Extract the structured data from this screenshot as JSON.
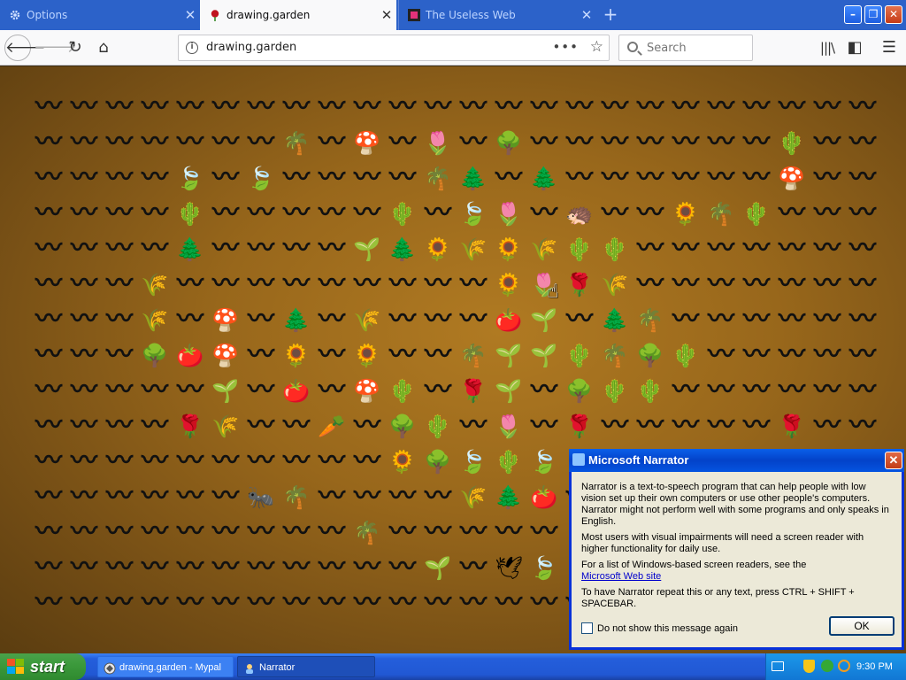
{
  "browser": {
    "tabs": [
      {
        "label": "Options",
        "icon": "gear-icon"
      },
      {
        "label": "drawing.garden",
        "icon": "rose-icon"
      },
      {
        "label": "The Useless Web",
        "icon": "pink-square-icon"
      }
    ],
    "url": "drawing.garden",
    "search_placeholder": "Search"
  },
  "garden": {
    "wave": "〰",
    "rows": [
      "wwwwwwwwwwwwwwwwwwwwwwww",
      "wwwwwwwPwMwTwBwwwwwwwCww",
      "wwwwLwLwwwwPFwFwwwwwwMww",
      "wwwwCwwwwwCwLTwHwwSPCwww",
      "wwwwFwwwwVFSYSYCCwwwwwww",
      "wwwYwwwwwwwwwSTRYwwwwwww",
      "wwwYwMwFwYwwwAVwFPwwwwww",
      "wwwBAMwSwSwwPVVCPBCwwwww",
      "wwwwwVwAwMCwRVwBCCwwwwww",
      "wwwwRYwwKwBCwTwRwwwwwRww",
      "wwwwwwwwwwSBLCLRwwwwwwww",
      "wwwwwwNPwwwwYFAwwwwwwwww",
      "wwwwwwwwwPwwwwwPwwwwwwww",
      "wwwwwwwwwwwVwDLRwwwwwwww",
      "wwwwwwwwwwwwwwwwwwwwwwww"
    ],
    "legend": {
      "w": "〰",
      "P": "🌴",
      "M": "🍄",
      "T": "🌷",
      "B": "🌳",
      "C": "🌵",
      "L": "🍃",
      "F": "🌲",
      "H": "🦔",
      "S": "🌻",
      "Y": "🌾",
      "R": "🌹",
      "A": "🍅",
      "V": "🌱",
      "K": "🥕",
      "N": "🐜",
      "D": "🕊",
      "E": "🍓",
      "Q": "🍀",
      "G": "🌸",
      "O": "🌼",
      "X": "🕷"
    }
  },
  "narrator_dialog": {
    "title": "Microsoft Narrator",
    "para1": "Narrator is a text-to-speech program that can help people with low vision set up their own computers or use other people's computers. Narrator might not perform well with some programs and only speaks in English.",
    "para2": "Most users with visual impairments will need a screen reader with higher functionality for daily use.",
    "para3": "For a list of Windows-based screen readers, see the",
    "link": "Microsoft Web site",
    "para4": "To have Narrator repeat this or any text, press CTRL + SHIFT + SPACEBAR.",
    "checkbox_label": "Do not show this message again",
    "ok_label": "OK"
  },
  "taskbar": {
    "start_label": "start",
    "items": [
      {
        "label": "drawing.garden - Mypal",
        "icon": "mypal-icon"
      },
      {
        "label": "Narrator",
        "icon": "narrator-icon"
      }
    ],
    "clock": "9:30 PM"
  }
}
